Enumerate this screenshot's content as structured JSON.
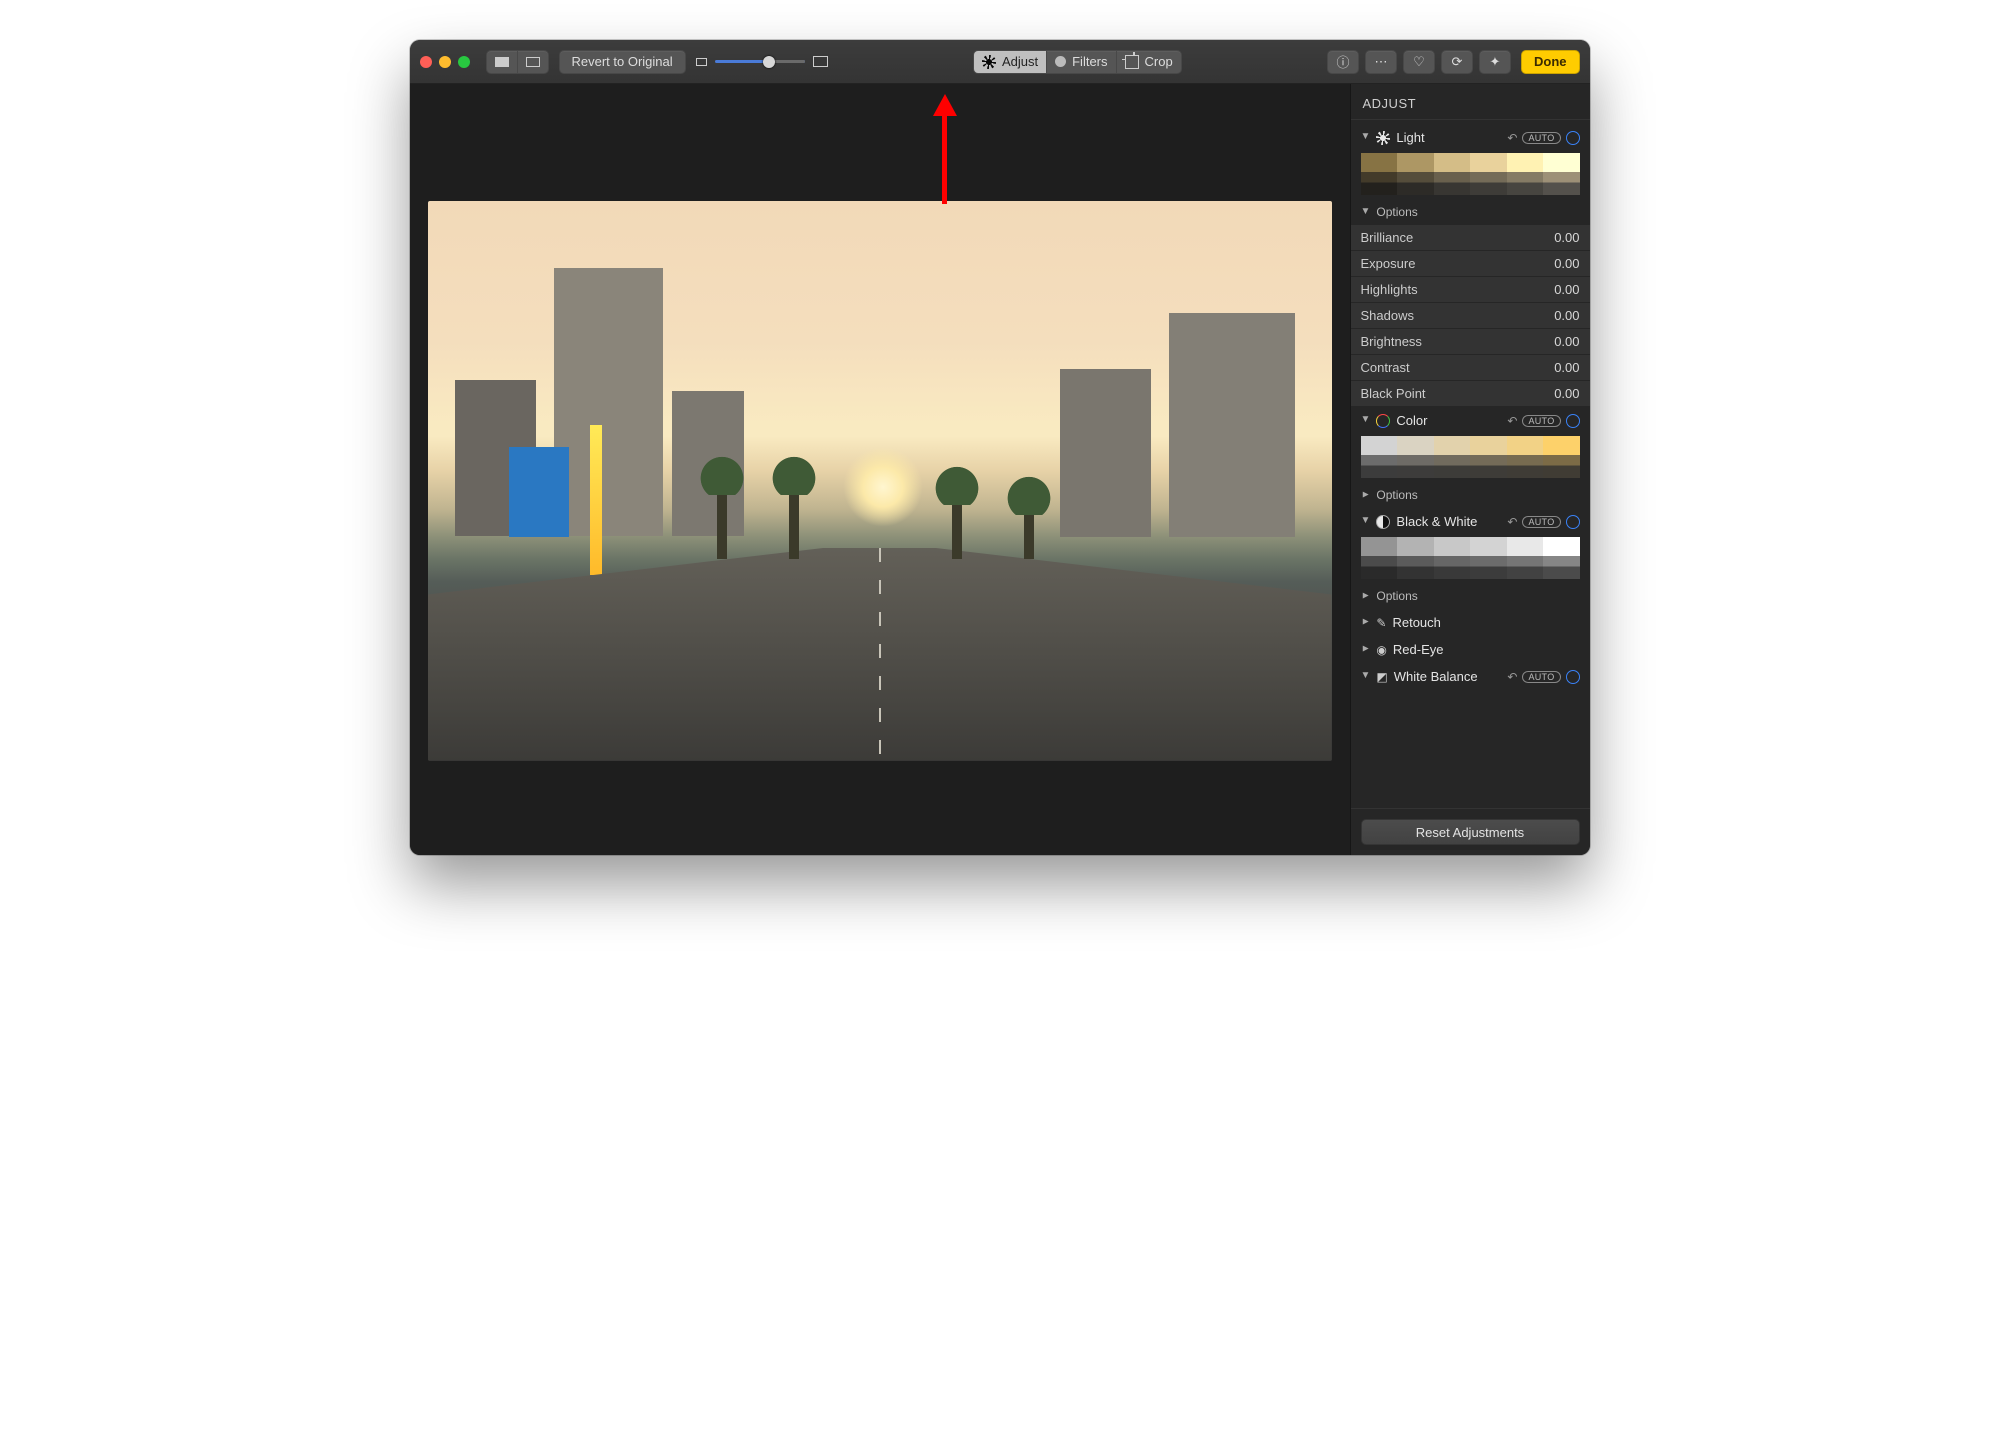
{
  "toolbar": {
    "revert_label": "Revert to Original",
    "tabs": {
      "adjust": "Adjust",
      "filters": "Filters",
      "crop": "Crop"
    },
    "done_label": "Done"
  },
  "sidebar": {
    "title": "ADJUST",
    "auto_label": "AUTO",
    "options_label": "Options",
    "reset_label": "Reset Adjustments",
    "sections": {
      "light": {
        "label": "Light",
        "sliders": [
          {
            "name": "Brilliance",
            "value": "0.00"
          },
          {
            "name": "Exposure",
            "value": "0.00"
          },
          {
            "name": "Highlights",
            "value": "0.00"
          },
          {
            "name": "Shadows",
            "value": "0.00"
          },
          {
            "name": "Brightness",
            "value": "0.00"
          },
          {
            "name": "Contrast",
            "value": "0.00"
          },
          {
            "name": "Black Point",
            "value": "0.00"
          }
        ]
      },
      "color": {
        "label": "Color"
      },
      "bw": {
        "label": "Black & White"
      },
      "retouch": {
        "label": "Retouch"
      },
      "redeye": {
        "label": "Red-Eye"
      },
      "wb": {
        "label": "White Balance"
      }
    }
  }
}
